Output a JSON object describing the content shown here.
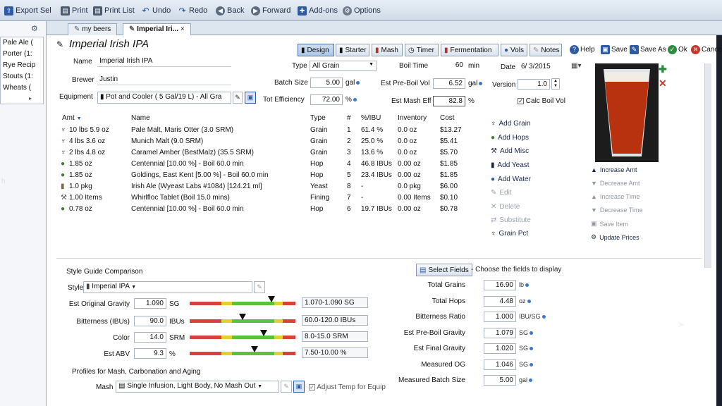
{
  "toolbar": {
    "export_sel": "Export Sel",
    "print": "Print",
    "print_list": "Print List",
    "undo": "Undo",
    "redo": "Redo",
    "back": "Back",
    "forward": "Forward",
    "addons": "Add-ons",
    "options": "Options"
  },
  "left_list": [
    "Pale Ale (",
    "Porter (1:",
    "Rye Recip",
    "Stouts (1:",
    "Wheats ("
  ],
  "left_h": "h",
  "tabs": [
    {
      "label": "my beers"
    },
    {
      "label": "Imperial Iri..."
    }
  ],
  "recipe": {
    "title": "Imperial Irish IPA",
    "name_label": "Name",
    "name": "Imperial Irish IPA",
    "brewer_label": "Brewer",
    "brewer": "Justin",
    "equipment_label": "Equipment",
    "equipment": "Pot and Cooler ( 5 Gal/19 L) - All Gra",
    "type_label": "Type",
    "type": "All Grain",
    "batch_label": "Batch Size",
    "batch": "5.00",
    "batch_unit": "gal",
    "eff_label": "Tot Efficiency",
    "eff": "72.00",
    "eff_unit": "%",
    "boil_label": "Boil Time",
    "boil": "60",
    "boil_unit": "min",
    "preboil_label": "Est Pre-Boil Vol",
    "preboil": "6.52",
    "preboil_unit": "gal",
    "mash_eff_label": "Est Mash Eff",
    "mash_eff": "82.8",
    "mash_eff_unit": "%",
    "date_label": "Date",
    "date": "6/ 3/2015",
    "version_label": "Version",
    "version": "1.0",
    "calc_boil": "Calc Boil Vol"
  },
  "view_tabs": [
    "Design",
    "Starter",
    "Mash",
    "Timer",
    "Fermentation",
    "Vols",
    "Notes"
  ],
  "header_actions": {
    "help": "Help",
    "save": "Save",
    "save_as": "Save As",
    "ok": "Ok",
    "cancel": "Cancel"
  },
  "grid": {
    "headers": {
      "amt": "Amt",
      "name": "Name",
      "type": "Type",
      "num": "#",
      "pct": "%/IBU",
      "inv": "Inventory",
      "cost": "Cost"
    },
    "rows": [
      {
        "amt": "10 lbs 5.9 oz",
        "name": "Pale Malt, Maris Otter (3.0 SRM)",
        "type": "Grain",
        "num": "1",
        "pct": "61.4 %",
        "inv": "0.0 oz",
        "cost": "$13.27",
        "icon": "grain"
      },
      {
        "amt": "4 lbs 3.6 oz",
        "name": "Munich Malt (9.0 SRM)",
        "type": "Grain",
        "num": "2",
        "pct": "25.0 %",
        "inv": "0.0 oz",
        "cost": "$5.41",
        "icon": "grain"
      },
      {
        "amt": "2 lbs 4.8 oz",
        "name": "Caramel Amber (BestMalz) (35.5 SRM)",
        "type": "Grain",
        "num": "3",
        "pct": "13.6 %",
        "inv": "0.0 oz",
        "cost": "$5.70",
        "icon": "grain"
      },
      {
        "amt": "1.85 oz",
        "name": "Centennial [10.00 %] - Boil 60.0 min",
        "type": "Hop",
        "num": "4",
        "pct": "46.8 IBUs",
        "inv": "0.00 oz",
        "cost": "$1.85",
        "icon": "hop"
      },
      {
        "amt": "1.85 oz",
        "name": "Goldings, East Kent [5.00 %] - Boil 60.0 min",
        "type": "Hop",
        "num": "5",
        "pct": "23.4 IBUs",
        "inv": "0.00 oz",
        "cost": "$1.85",
        "icon": "hop"
      },
      {
        "amt": "1.0 pkg",
        "name": "Irish Ale (Wyeast Labs #1084) [124.21 ml]",
        "type": "Yeast",
        "num": "8",
        "pct": "-",
        "inv": "0.0 pkg",
        "cost": "$6.00",
        "icon": "yeast"
      },
      {
        "amt": "1.00 Items",
        "name": "Whirlfloc Tablet (Boil 15.0 mins)",
        "type": "Fining",
        "num": "7",
        "pct": "-",
        "inv": "0.00 Items",
        "cost": "$0.10",
        "icon": "fining"
      },
      {
        "amt": "0.78 oz",
        "name": "Centennial [10.00 %] - Boil 60.0 min",
        "type": "Hop",
        "num": "6",
        "pct": "19.7 IBUs",
        "inv": "0.00 oz",
        "cost": "$0.78",
        "icon": "hop"
      }
    ]
  },
  "actions": [
    "Add Grain",
    "Add Hops",
    "Add Misc",
    "Add Yeast",
    "Add Water",
    "Edit",
    "Delete",
    "Substitute",
    "Grain Pct"
  ],
  "side_actions": [
    "Increase Amt",
    "Decrease Amt",
    "Increase Time",
    "Decrease Time",
    "Save Item",
    "Update Prices"
  ],
  "style": {
    "section": "Style Guide Comparison",
    "style_label": "Style",
    "style": "Imperial IPA",
    "og_label": "Est Original Gravity",
    "og": "1.090",
    "og_unit": "SG",
    "og_range": "1.070-1.090 SG",
    "og_pos": 0.77,
    "ibu_label": "Bitterness (IBUs)",
    "ibu": "90.0",
    "ibu_unit": "IBUs",
    "ibu_range": "60.0-120.0 IBUs",
    "ibu_pos": 0.5,
    "color_label": "Color",
    "color": "14.0",
    "color_unit": "SRM",
    "color_range": "8.0-15.0 SRM",
    "color_pos": 0.7,
    "abv_label": "Est ABV",
    "abv": "9.3",
    "abv_unit": "%",
    "abv_range": "7.50-10.00 %",
    "abv_pos": 0.61,
    "profiles": "Profiles for Mash, Carbonation and Aging",
    "mash_label": "Mash",
    "mash": "Single Infusion, Light Body, No Mash Out",
    "adjust": "Adjust Temp for Equip"
  },
  "fields": {
    "select_fields": "Select Fields",
    "hint": "- Choose the fields to display",
    "rows": [
      {
        "label": "Total Grains",
        "value": "16.90",
        "unit": "lb"
      },
      {
        "label": "Total Hops",
        "value": "4.48",
        "unit": "oz"
      },
      {
        "label": "Bitterness Ratio",
        "value": "1.000",
        "unit": "IBU/SG"
      },
      {
        "label": "Est Pre-Boil Gravity",
        "value": "1.079",
        "unit": "SG"
      },
      {
        "label": "Est Final Gravity",
        "value": "1.020",
        "unit": "SG"
      },
      {
        "label": "Measured OG",
        "value": "1.046",
        "unit": "SG"
      },
      {
        "label": "Measured Batch Size",
        "value": "5.00",
        "unit": "gal"
      }
    ]
  },
  "colors": {
    "beer": "#b8320f",
    "accent": "#3a78d0"
  }
}
